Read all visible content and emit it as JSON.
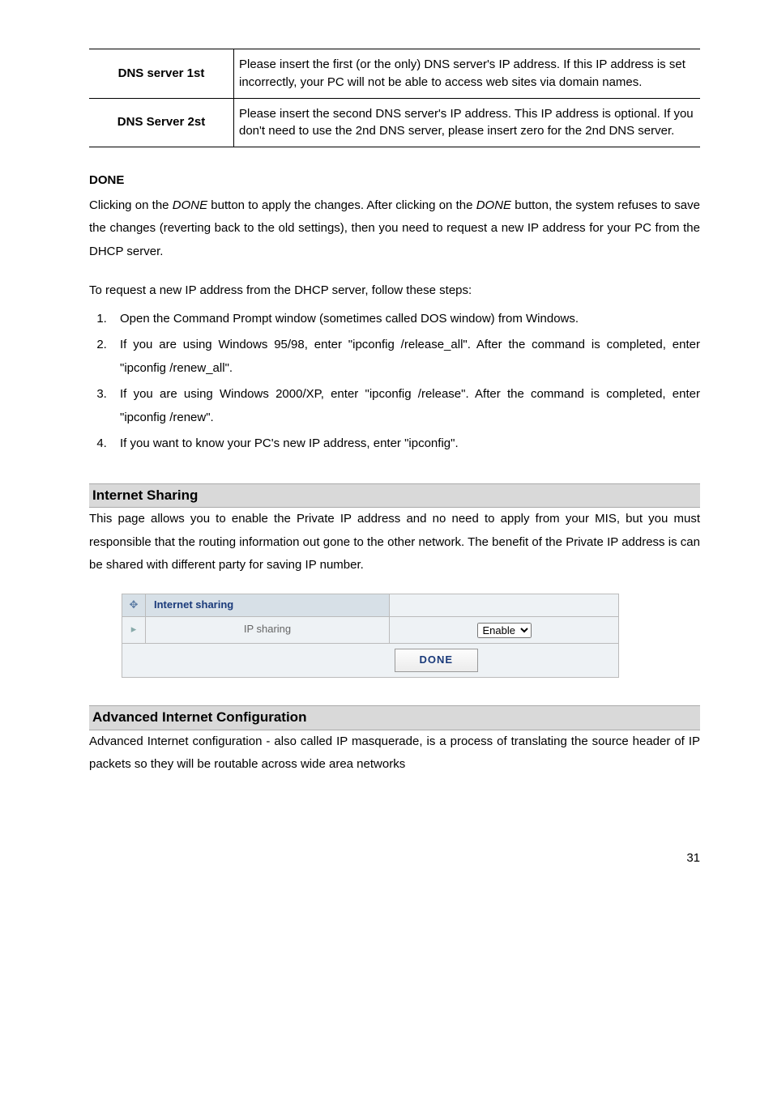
{
  "dns_table": {
    "row1": {
      "label": "DNS server 1st",
      "desc": "Please insert the first (or the only) DNS server's IP address. If this IP address is set incorrectly, your PC will not be able to access web sites via domain names."
    },
    "row2": {
      "label": "DNS Server 2st",
      "desc": "Please insert the second DNS server's IP address. This IP address is optional. If you don't need to use the 2nd DNS server, please insert zero for the 2nd DNS server."
    }
  },
  "done_section": {
    "heading": "DONE",
    "paragraph": "Clicking on the DONE button to apply the changes. After clicking on the DONE button, the system refuses to save the changes (reverting back to the old settings), then you need to request a new IP address for your PC from the DHCP server."
  },
  "steps_intro": "To request a new IP address from the DHCP server, follow these steps:",
  "steps": [
    "Open the Command Prompt window (sometimes called DOS window) from Windows.",
    "If you are using Windows 95/98, enter \"ipconfig /release_all\". After the command is completed, enter \"ipconfig /renew_all\".",
    "If you are using Windows 2000/XP, enter \"ipconfig /release\". After the command is completed, enter \"ipconfig /renew\".",
    "If you want to know your PC's new IP address, enter \"ipconfig\"."
  ],
  "internet_sharing": {
    "heading": "Internet Sharing",
    "paragraph": "This page allows you to enable the Private IP address and no need to apply from your MIS, but you must responsible that the routing information out gone to the other network. The benefit of the Private IP address is can be shared with different party for saving IP number.",
    "ui": {
      "header_icon": "✥",
      "header_label": "Internet sharing",
      "row_icon": "▸",
      "row_label": "IP sharing",
      "row_value": "Enable",
      "done_label": "DONE"
    }
  },
  "advanced": {
    "heading": "Advanced Internet Configuration",
    "paragraph": "Advanced Internet configuration - also called IP masquerade, is a process of translating the source header of IP packets so they will be routable across wide area networks"
  },
  "page_number": "31"
}
